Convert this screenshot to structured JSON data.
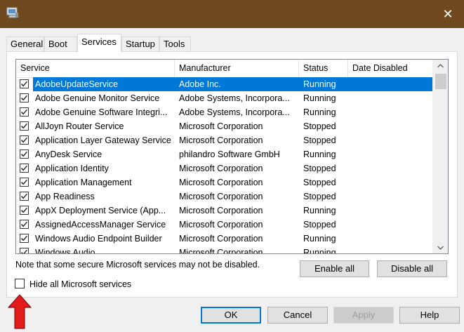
{
  "window": {
    "close_glyph": "✕"
  },
  "tabs": [
    {
      "label": "General"
    },
    {
      "label": "Boot"
    },
    {
      "label": "Services",
      "active": true
    },
    {
      "label": "Startup"
    },
    {
      "label": "Tools"
    }
  ],
  "columns": [
    "Service",
    "Manufacturer",
    "Status",
    "Date Disabled"
  ],
  "services": [
    {
      "checked": true,
      "name": "AdobeUpdateService",
      "manufacturer": "Adobe Inc.",
      "status": "Running",
      "selected": true
    },
    {
      "checked": true,
      "name": "Adobe Genuine Monitor Service",
      "manufacturer": "Adobe Systems, Incorpora...",
      "status": "Running"
    },
    {
      "checked": true,
      "name": "Adobe Genuine Software Integri...",
      "manufacturer": "Adobe Systems, Incorpora...",
      "status": "Running"
    },
    {
      "checked": true,
      "name": "AllJoyn Router Service",
      "manufacturer": "Microsoft Corporation",
      "status": "Stopped"
    },
    {
      "checked": true,
      "name": "Application Layer Gateway Service",
      "manufacturer": "Microsoft Corporation",
      "status": "Stopped"
    },
    {
      "checked": true,
      "name": "AnyDesk Service",
      "manufacturer": "philandro Software GmbH",
      "status": "Running"
    },
    {
      "checked": true,
      "name": "Application Identity",
      "manufacturer": "Microsoft Corporation",
      "status": "Stopped"
    },
    {
      "checked": true,
      "name": "Application Management",
      "manufacturer": "Microsoft Corporation",
      "status": "Stopped"
    },
    {
      "checked": true,
      "name": "App Readiness",
      "manufacturer": "Microsoft Corporation",
      "status": "Stopped"
    },
    {
      "checked": true,
      "name": "AppX Deployment Service (App...",
      "manufacturer": "Microsoft Corporation",
      "status": "Running"
    },
    {
      "checked": true,
      "name": "AssignedAccessManager Service",
      "manufacturer": "Microsoft Corporation",
      "status": "Stopped"
    },
    {
      "checked": true,
      "name": "Windows Audio Endpoint Builder",
      "manufacturer": "Microsoft Corporation",
      "status": "Running"
    },
    {
      "checked": true,
      "name": "Windows Audio",
      "manufacturer": "Microsoft Corporation",
      "status": "Running"
    }
  ],
  "note": "Note that some secure Microsoft services may not be disabled.",
  "enable_all": "Enable all",
  "disable_all": "Disable all",
  "hide_ms_services": {
    "label": "Hide all Microsoft services",
    "checked": false
  },
  "footer": {
    "ok": "OK",
    "cancel": "Cancel",
    "apply": "Apply",
    "help": "Help"
  },
  "colors": {
    "titlebar": "#70491f",
    "selection": "#0078d7",
    "annotation_arrow": "#e21b1b"
  }
}
